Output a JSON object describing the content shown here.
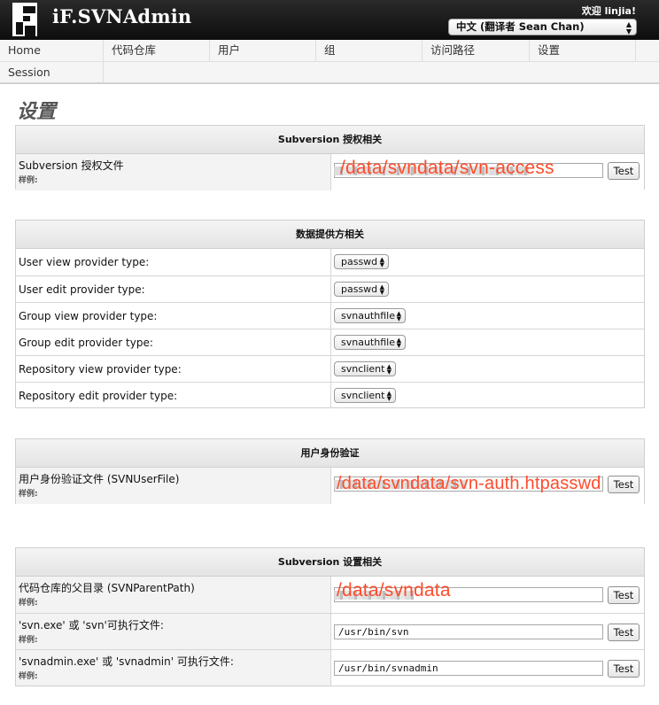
{
  "header": {
    "app_title": "iF.SVNAdmin",
    "welcome": "欢迎 linjia!",
    "language": "中文 (翻译者 Sean Chan)"
  },
  "nav": {
    "row1": [
      "Home",
      "代码仓库",
      "用户",
      "组",
      "访问路径",
      "设置"
    ],
    "row2": [
      "Session"
    ]
  },
  "page_title": "设置",
  "sections": {
    "authz": {
      "title": "Subversion 授权相关",
      "file_label": "Subversion 授权文件",
      "example_label": "样例:",
      "overlay": "/data/svndata/svn-access",
      "test_label": "Test"
    },
    "providers": {
      "title": "数据提供方相关",
      "rows": [
        {
          "label": "User view provider type:",
          "value": "passwd"
        },
        {
          "label": "User edit provider type:",
          "value": "passwd"
        },
        {
          "label": "Group view provider type:",
          "value": "svnauthfile"
        },
        {
          "label": "Group edit provider type:",
          "value": "svnauthfile"
        },
        {
          "label": "Repository view provider type:",
          "value": "svnclient"
        },
        {
          "label": "Repository edit provider type:",
          "value": "svnclient"
        }
      ]
    },
    "auth": {
      "title": "用户身份验证",
      "file_label": "用户身份验证文件 (SVNUserFile)",
      "example_label": "样例:",
      "overlay": "/data/svndata/svn-auth.htpasswd",
      "test_label": "Test"
    },
    "svn": {
      "title": "Subversion 设置相关",
      "parent_label": "代码仓库的父目录 (SVNParentPath)",
      "parent_overlay": "/data/svndata",
      "svn_exe_label": "'svn.exe' 或 'svn'可执行文件:",
      "svn_exe_value": "/usr/bin/svn",
      "svnadmin_label": "'svnadmin.exe' 或 'svnadmin' 可执行文件:",
      "svnadmin_value": "/usr/bin/svnadmin",
      "example_label": "样例:",
      "test_label": "Test"
    }
  },
  "colors": {
    "header_bg": "#111111",
    "overlay_text": "#ff4b2b"
  },
  "icons": [
    "logo-icon",
    "select-arrows-icon"
  ]
}
